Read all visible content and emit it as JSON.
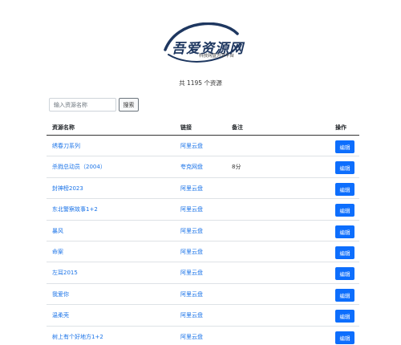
{
  "logo": {
    "title": "吾爱资源网",
    "subtitle": "科技网盘分享平台"
  },
  "summary": {
    "count_text": "共 1195 个资源"
  },
  "search": {
    "placeholder": "输入资源名称",
    "button_label": "搜索"
  },
  "table": {
    "headers": {
      "name": "资源名称",
      "link": "链接",
      "note": "备注",
      "action": "操作"
    },
    "rows": [
      {
        "name": "绣春刀系列",
        "link": "阿里云盘",
        "note": "",
        "action": "编辑"
      },
      {
        "name": "杀戮总动员（2004）",
        "link": "夸克网盘",
        "note": "8分",
        "action": "编辑"
      },
      {
        "name": "封神榜2023",
        "link": "阿里云盘",
        "note": "",
        "action": "编辑"
      },
      {
        "name": "东北警察故事1+2",
        "link": "阿里云盘",
        "note": "",
        "action": "编辑"
      },
      {
        "name": "暴风",
        "link": "阿里云盘",
        "note": "",
        "action": "编辑"
      },
      {
        "name": "命案",
        "link": "阿里云盘",
        "note": "",
        "action": "编辑"
      },
      {
        "name": "左耳2015",
        "link": "阿里云盘",
        "note": "",
        "action": "编辑"
      },
      {
        "name": "我爱你",
        "link": "阿里云盘",
        "note": "",
        "action": "编辑"
      },
      {
        "name": "温柔壳",
        "link": "阿里云盘",
        "note": "",
        "action": "编辑"
      },
      {
        "name": "树上有个好地方1+2",
        "link": "阿里云盘",
        "note": "",
        "action": "编辑"
      }
    ]
  },
  "colors": {
    "link": "#1a73e8",
    "button": "#0d6efd",
    "logo": "#1e3760"
  }
}
